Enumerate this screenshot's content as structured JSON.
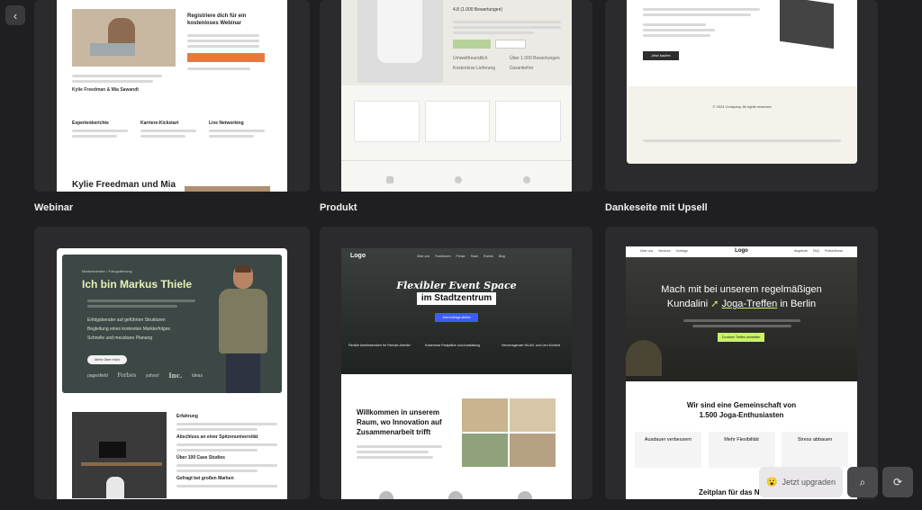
{
  "nav": {
    "back_icon": "chevron-left-icon"
  },
  "labels": {
    "webinar": "Webinar",
    "produkt": "Produkt",
    "dankeseite": "Dankeseite mit Upsell"
  },
  "webinar_thumb": {
    "register_title": "Registriere dich für ein kostenloses Webinar",
    "hosts": "Kylie Freedman & Mia Sawandt",
    "features": [
      "Expertenberichte",
      "Karriere-Kickstart",
      "Live Networking"
    ],
    "bottom_heading": "Kylie Freedman und Mia"
  },
  "produkt_thumb": {
    "rating_note": "4.8 (1.000 Bewertungen)",
    "features": [
      "Umweltfreundlich",
      "Über 1.000 Bewertungen",
      "Kostenlose Lieferung",
      "Garantiefrei"
    ]
  },
  "danke_thumb": {
    "cta": "Jetzt kaufen",
    "footer": "© 2024 Company. All rights reserved"
  },
  "markus_thumb": {
    "kicker": "Markenberater • Fotografierung",
    "headline": "Ich bin Markus Thiele",
    "bullets": [
      "Erfolgsberater auf geführten Strukturen",
      "Begleitung eines konkreten Markterfolges",
      "Schnelle und messbare Planung"
    ],
    "cta": "Mehr über mich",
    "logos": [
      "pagesfield",
      "Forbes",
      "yahoo!",
      "Inc.",
      "ideas"
    ],
    "list_items": [
      "Erfahrung",
      "Abschluss an einer Spitzenuniversität",
      "Über 100 Case Studies",
      "Gefragt bei großen Marken"
    ]
  },
  "event_thumb": {
    "logo": "Logo",
    "nav": [
      "Über uns",
      "Funktionen",
      "Preise",
      "Team",
      "Events",
      "Blog"
    ],
    "headline_line1": "Flexibler Event Space",
    "headline_line2": "im Stadtzentrum",
    "cta": "Jetzt Anfrage stellen",
    "stats": [
      "Flexible Arbeitsbereiche für Remote-Arbeiter",
      "Kostenlose Parkplätze und Ausstattung",
      "Hervorragender WLAN- und Lern-Komfort"
    ],
    "welcome": "Willkommen in unserem Raum, wo Innovation auf Zusammenarbeit trifft"
  },
  "yoga_thumb": {
    "logo": "Logo",
    "nav_left": [
      "Über uns",
      "Services",
      "Vorträge"
    ],
    "nav_right": [
      "Angebote",
      "FAQ",
      "Preise/Kurse"
    ],
    "headline_line1": "Mach mit bei unserem regelmäßigen",
    "headline_line2_a": "Kundalini",
    "headline_line2_b": "Joga-Treffen",
    "headline_line2_c": "in Berlin",
    "cta": "Zu einem Treffen anmelden",
    "community_line1": "Wir sind eine Gemeinschaft von",
    "community_line2": "1.500 Joga-Enthusiasten",
    "benefits": [
      "Ausdauer verbessern",
      "Mehr Flexibilität",
      "Stress abbauen"
    ],
    "schedule": "Zeitplan für das N"
  },
  "bottom": {
    "upgrade_label": "Jetzt upgraden",
    "upgrade_icon": "emoji-face-icon",
    "search_icon": "search-icon",
    "refresh_icon": "refresh-icon"
  },
  "colors": {
    "accent_orange": "#e57a3f",
    "accent_green": "#c9f26b",
    "accent_blue": "#3d5cf5",
    "bg": "#1f1f21"
  }
}
